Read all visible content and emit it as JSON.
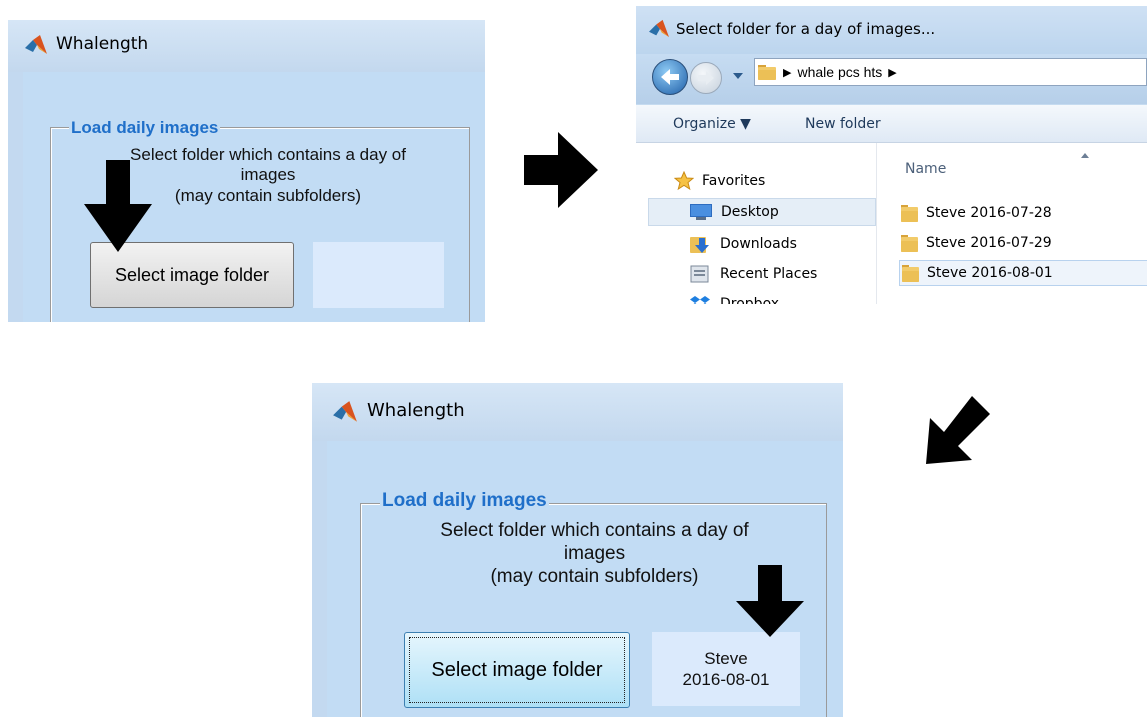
{
  "panel_top_left": {
    "window_title": "Whalength",
    "panel_title": "Load daily images",
    "instruction_lines": [
      "Select folder which contains a day of",
      "images",
      "(may contain subfolders)"
    ],
    "button_label": "Select image folder",
    "folder_display": ""
  },
  "dialog": {
    "title": "Select folder for a day of images...",
    "breadcrumb": [
      "whale pcs hts"
    ],
    "toolbar": {
      "organize": "Organize ▼",
      "new_folder": "New folder"
    },
    "nav_items": [
      {
        "label": "Favorites",
        "icon": "star-icon"
      },
      {
        "label": "Desktop",
        "icon": "desktop-icon"
      },
      {
        "label": "Downloads",
        "icon": "downloads-icon"
      },
      {
        "label": "Recent Places",
        "icon": "recent-places-icon"
      },
      {
        "label": "Dropbox",
        "icon": "dropbox-icon"
      }
    ],
    "column_header": "Name",
    "files": [
      "Steve 2016-07-28",
      "Steve 2016-07-29",
      "Steve 2016-08-01"
    ],
    "selected_file": "Steve 2016-08-01"
  },
  "panel_bottom": {
    "window_title": "Whalength",
    "panel_title": "Load daily images",
    "instruction_lines": [
      "Select folder which contains a day of",
      "images",
      "(may contain subfolders)"
    ],
    "button_label": "Select image folder",
    "folder_display_lines": [
      "Steve",
      "2016-08-01"
    ]
  },
  "colors": {
    "panel_title": "#1f6fc9",
    "window_bg": "#c2dcf4",
    "arrow": "#000000"
  }
}
